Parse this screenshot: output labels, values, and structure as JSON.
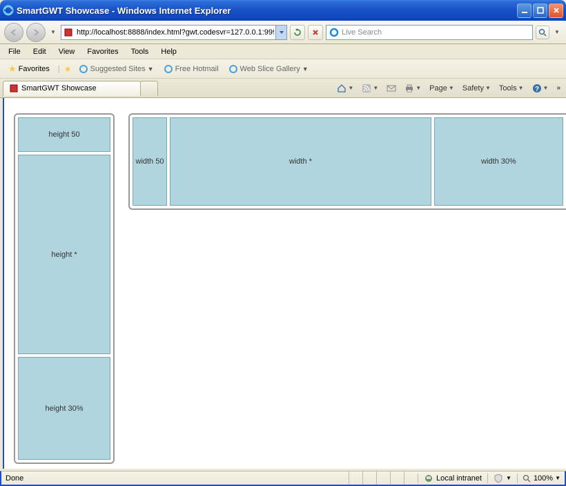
{
  "window": {
    "title": "SmartGWT Showcase - Windows Internet Explorer"
  },
  "address": {
    "url": "http://localhost:8888/index.html?gwt.codesvr=127.0.0.1:999"
  },
  "search": {
    "placeholder": "Live Search"
  },
  "menu": {
    "file": "File",
    "edit": "Edit",
    "view": "View",
    "favorites": "Favorites",
    "tools": "Tools",
    "help": "Help"
  },
  "favbar": {
    "favorites_label": "Favorites",
    "suggested": "Suggested Sites",
    "hotmail": "Free Hotmail",
    "webslice": "Web Slice Gallery"
  },
  "tab": {
    "title": "SmartGWT Showcase"
  },
  "cmd": {
    "page": "Page",
    "safety": "Safety",
    "tools": "Tools"
  },
  "layout": {
    "v1": "height 50",
    "v2": "height *",
    "v3": "height 30%",
    "h1": "width 50",
    "h2": "width *",
    "h3": "width 30%"
  },
  "status": {
    "text": "Done",
    "zone": "Local intranet",
    "zoom": "100%"
  }
}
